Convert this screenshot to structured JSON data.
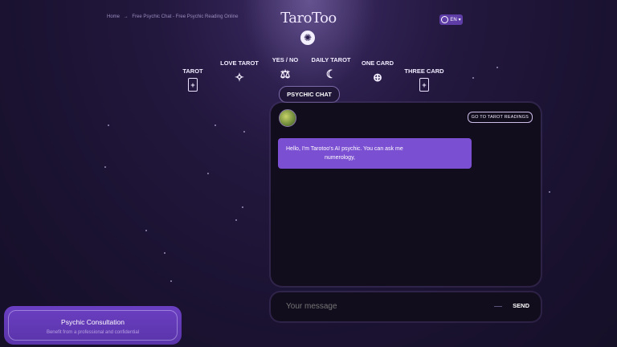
{
  "breadcrumb": {
    "items": [
      "Home",
      "→",
      "Free Psychic Chat - Free Psychic Reading Online"
    ]
  },
  "brand": {
    "logo_text": "TaroToo",
    "badge_icon": "moon-sun-emblem-icon"
  },
  "lang": {
    "label": "EN",
    "icon": "globe-icon"
  },
  "nav": {
    "items": [
      {
        "label": "TAROT",
        "icon": "card-icon"
      },
      {
        "label": "LOVE TAROT",
        "icon": "heart-sparkle-icon"
      },
      {
        "label": "YES / NO",
        "icon": "balance-icon"
      },
      {
        "label": "DAILY TAROT",
        "icon": "moon-day-icon"
      },
      {
        "label": "ONE CARD",
        "icon": "orbit-card-icon"
      },
      {
        "label": "THREE CARD",
        "icon": "card-icon"
      }
    ]
  },
  "chat": {
    "tab_label": "PSYCHIC CHAT",
    "go_button": "GO TO TAROT READINGS",
    "greeting_line1": "Hello, I'm Tarotoo's AI psychic. You can ask me",
    "greeting_line2": "numerology,",
    "input_placeholder": "Your message",
    "send_label": "SEND"
  },
  "consult": {
    "title": "Psychic Consultation",
    "subtitle": "Benefit from a professional and confidential"
  },
  "colors": {
    "accent": "#7b4fd1",
    "background": "#1a1230"
  }
}
